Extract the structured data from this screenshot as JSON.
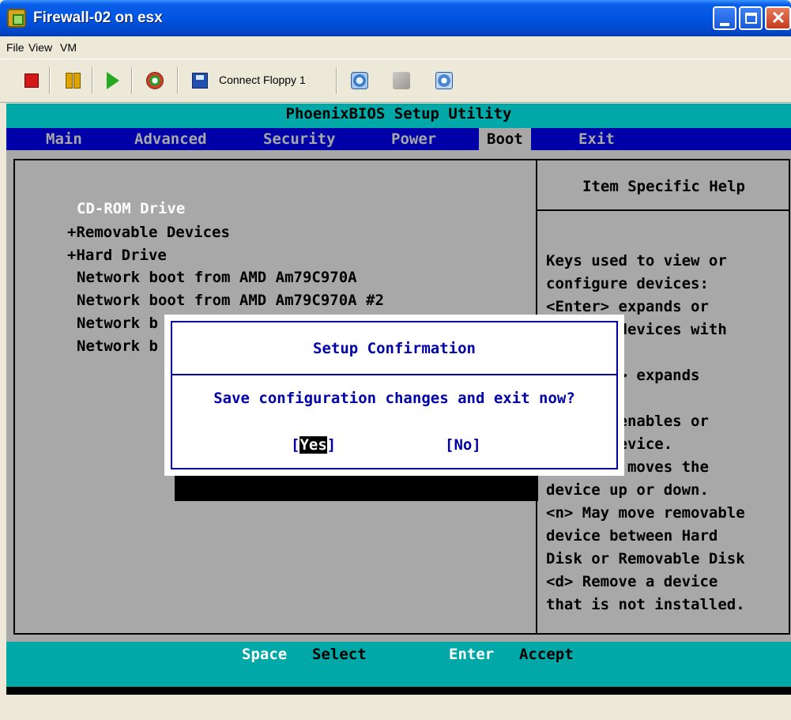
{
  "window": {
    "title": "Firewall-02 on esx",
    "menu": [
      "File",
      "View",
      "VM"
    ],
    "toolbar": {
      "connect_floppy_label": "Connect Floppy 1"
    }
  },
  "bios": {
    "title": "PhoenixBIOS Setup Utility",
    "menu": [
      "Main",
      "Advanced",
      "Security",
      "Power",
      "Boot",
      "Exit"
    ],
    "active_menu": "Boot",
    "boot_order": [
      "CD-ROM Drive",
      "+Removable Devices",
      "+Hard Drive",
      "Network boot from AMD Am79C970A",
      "Network boot from AMD Am79C970A #2",
      "Network b",
      "Network b"
    ],
    "help": {
      "title": "Item Specific Help",
      "lines": [
        "Keys used to view or",
        "configure devices:",
        "<Enter> expands or",
        "      s devices with",
        "",
        "     ter> expands",
        "",
        "     1> enables or",
        "     a device.",
        "     <-> moves the",
        "device up or down.",
        "<n> May move removable",
        "device between Hard",
        "Disk or Removable Disk",
        "<d> Remove a device",
        "that is not installed."
      ]
    },
    "dialog": {
      "title": "Setup Confirmation",
      "message": "Save configuration changes and exit now?",
      "yes_open": "[",
      "yes_label": "Yes",
      "yes_close": "]",
      "no_label": "[No]"
    },
    "footer": {
      "select_key": "Space",
      "select_label": "Select",
      "accept_key": "Enter",
      "accept_label": "Accept"
    }
  }
}
